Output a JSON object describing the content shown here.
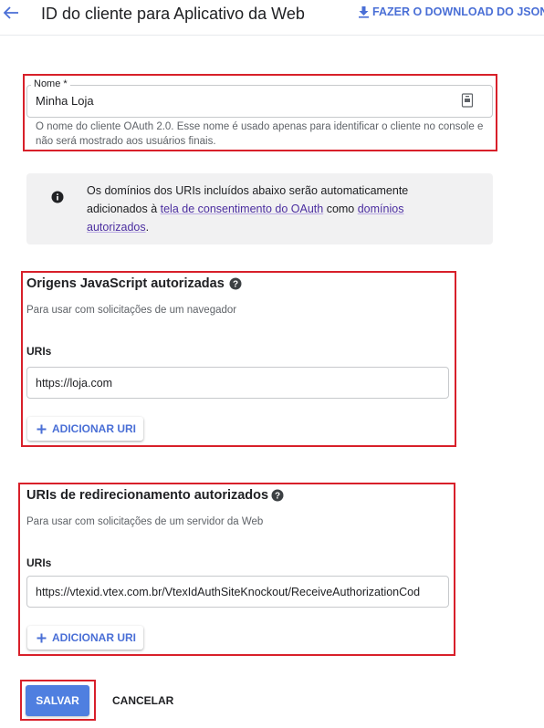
{
  "header": {
    "title": "ID do cliente para Aplicativo da Web",
    "download_label": "FAZER O DOWNLOAD DO JSON",
    "accent": "#4a6fd6"
  },
  "name_field": {
    "label": "Nome *",
    "value": "Minha Loja",
    "help": "O nome do cliente OAuth 2.0. Esse nome é usado apenas para identificar o cliente no console e não será mostrado aos usuários finais."
  },
  "info": {
    "text_before": "Os domínios dos URIs incluídos abaixo serão automaticamente adicionados à ",
    "link1": "tela de consentimento do OAuth",
    "text_middle": " como ",
    "link2": "domínios autorizados",
    "text_after": "."
  },
  "js_origins": {
    "title": "Origens JavaScript autorizadas",
    "subtitle": "Para usar com solicitações de um navegador",
    "uris_label": "URIs",
    "uri_value": "https://loja.com",
    "add_label": "ADICIONAR URI"
  },
  "redirects": {
    "title": "URIs de redirecionamento autorizados",
    "subtitle": "Para usar com solicitações de um servidor da Web",
    "uris_label": "URIs",
    "uri_value": "https://vtexid.vtex.com.br/VtexIdAuthSiteKnockout/ReceiveAuthorizationCod",
    "add_label": "ADICIONAR URI"
  },
  "actions": {
    "save_label": "SALVAR",
    "cancel_label": "CANCELAR"
  },
  "colors": {
    "annotation_red": "#d8202a",
    "primary_button": "#4f7fe0",
    "link_purple": "#4b2ea0"
  }
}
